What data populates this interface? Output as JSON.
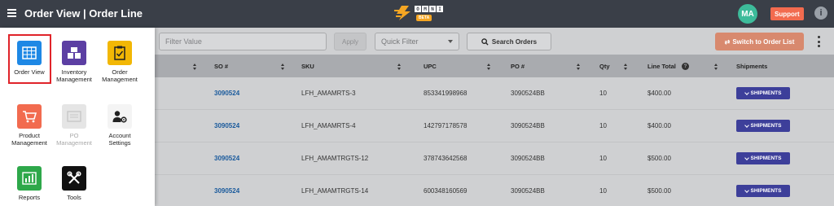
{
  "header": {
    "title": "Order View | Order Line",
    "logo": {
      "letters": [
        "O",
        "M",
        "N",
        "I"
      ],
      "badge": "BETA"
    },
    "avatar_initials": "MA",
    "support_label": "Support",
    "info_glyph": "i"
  },
  "toolbar": {
    "filter_placeholder": "Filter Value",
    "apply_label": "Apply",
    "quick_filter_label": "Quick Filter",
    "search_label": "Search Orders",
    "switch_label": "Switch to Order List"
  },
  "table": {
    "columns": [
      "SO #",
      "SKU",
      "UPC",
      "PO #",
      "Qty",
      "Line Total",
      "Shipments"
    ],
    "rows": [
      {
        "so": "3090524",
        "sku": "LFH_AMAMRTS-3",
        "upc": "853341998968",
        "po": "3090524BB",
        "qty": "10",
        "total": "$400.00",
        "shipments": "SHIPMENTS"
      },
      {
        "so": "3090524",
        "sku": "LFH_AMAMRTS-4",
        "upc": "142797178578",
        "po": "3090524BB",
        "qty": "10",
        "total": "$400.00",
        "shipments": "SHIPMENTS"
      },
      {
        "so": "3090524",
        "sku": "LFH_AMAMTRGTS-12",
        "upc": "378743642568",
        "po": "3090524BB",
        "qty": "10",
        "total": "$500.00",
        "shipments": "SHIPMENTS"
      },
      {
        "so": "3090524",
        "sku": "LFH_AMAMTRGTS-14",
        "upc": "600348160569",
        "po": "3090524BB",
        "qty": "10",
        "total": "$500.00",
        "shipments": "SHIPMENTS"
      }
    ]
  },
  "menu": {
    "items": [
      {
        "label1": "Order View",
        "label2": "",
        "icon": "grid-icon",
        "color": "#1e88e5"
      },
      {
        "label1": "Inventory",
        "label2": "Management",
        "icon": "boxes-icon",
        "color": "#5c3fa3"
      },
      {
        "label1": "Order",
        "label2": "Management",
        "icon": "clipboard-icon",
        "color": "#f2b705"
      },
      {
        "label1": "Product",
        "label2": "Management",
        "icon": "cart-icon",
        "color": "#f26b4f"
      },
      {
        "label1": "PO",
        "label2": "Management",
        "icon": "document-icon",
        "color": "#e5e5e5"
      },
      {
        "label1": "Account",
        "label2": "Settings",
        "icon": "user-gear-icon",
        "color": "#f4f4f4"
      },
      {
        "label1": "Reports",
        "label2": "",
        "icon": "bar-chart-icon",
        "color": "#2ea84a"
      },
      {
        "label1": "Tools",
        "label2": "",
        "icon": "tools-icon",
        "color": "#111111"
      }
    ]
  }
}
